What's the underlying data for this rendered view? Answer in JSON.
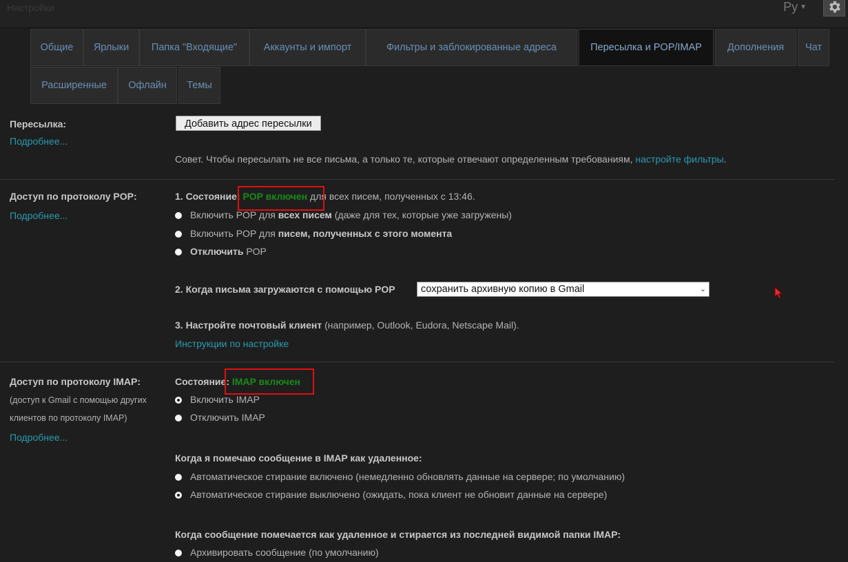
{
  "header": {
    "ghost_title": "Настройки",
    "language": "Ру"
  },
  "tabs": [
    {
      "label": "Общие"
    },
    {
      "label": "Ярлыки"
    },
    {
      "label": "Папка \"Входящие\""
    },
    {
      "label": "Аккаунты и импорт"
    },
    {
      "label": "Фильтры и заблокированные адреса"
    },
    {
      "label": "Пересылка и POP/IMAP",
      "active": true
    },
    {
      "label": "Дополнения"
    },
    {
      "label": "Чат"
    },
    {
      "label": "Расширенные"
    },
    {
      "label": "Офлайн"
    },
    {
      "label": "Темы"
    }
  ],
  "forwarding": {
    "title": "Пересылка:",
    "more_link": "Подробнее...",
    "add_button": "Добавить адрес пересылки",
    "tip_text": "Совет. Чтобы пересылать не все письма, а только те, которые отвечают определенным требованиям,",
    "tip_link": "настройте фильтры",
    "tip_end": "."
  },
  "pop": {
    "title": "Доступ по протоколу POP:",
    "more_link": "Подробнее...",
    "status_prefix": "1. Состояние:",
    "status_value": "POP включен",
    "status_suffix": "для всех писем, полученных с 13:46.",
    "options": [
      {
        "pre": "Включить POP для ",
        "bold": "всех писем",
        "post": " (даже для тех, которые уже загружены)"
      },
      {
        "pre": "Включить POP для ",
        "bold": "писем, полученных с этого момента",
        "post": ""
      },
      {
        "pre": "",
        "bold": "Отключить",
        "post": " POP"
      }
    ],
    "when_label": "2. Когда письма загружаются с помощью POP",
    "when_value": "сохранить архивную копию в Gmail",
    "client_bold": "3. Настройте почтовый клиент",
    "client_rest": " (например, Outlook, Eudora, Netscape Mail).",
    "instructions_link": "Инструкции по настройке"
  },
  "imap": {
    "title": "Доступ по протоколу IMAP:",
    "subtitle_line1": "(доступ к Gmail с помощью других",
    "subtitle_line2": "клиентов по протоколу IMAP)",
    "more_link": "Подробнее...",
    "status_prefix": "Состояние:",
    "status_value": "IMAP включен",
    "options": [
      "Включить IMAP",
      "Отключить IMAP"
    ],
    "delete_heading": "Когда я помечаю сообщение в IMAP как удаленное:",
    "delete_options": [
      "Автоматическое стирание включено (немедленно обновлять данные на сервере; по умолчанию)",
      "Автоматическое стирание выключено (ожидать, пока клиент не обновит данные на сервере)"
    ],
    "expunge_heading": "Когда сообщение помечается как удаленное и стирается из последней видимой папки IMAP:",
    "expunge_first_option": "Архивировать сообщение (по умолчанию)"
  },
  "colors": {
    "background": "#1e1e1e",
    "link": "#2a9bb0",
    "status_green": "#1a8a1a",
    "highlight_box": "#e01010",
    "tab_text": "#6a8fb5"
  }
}
